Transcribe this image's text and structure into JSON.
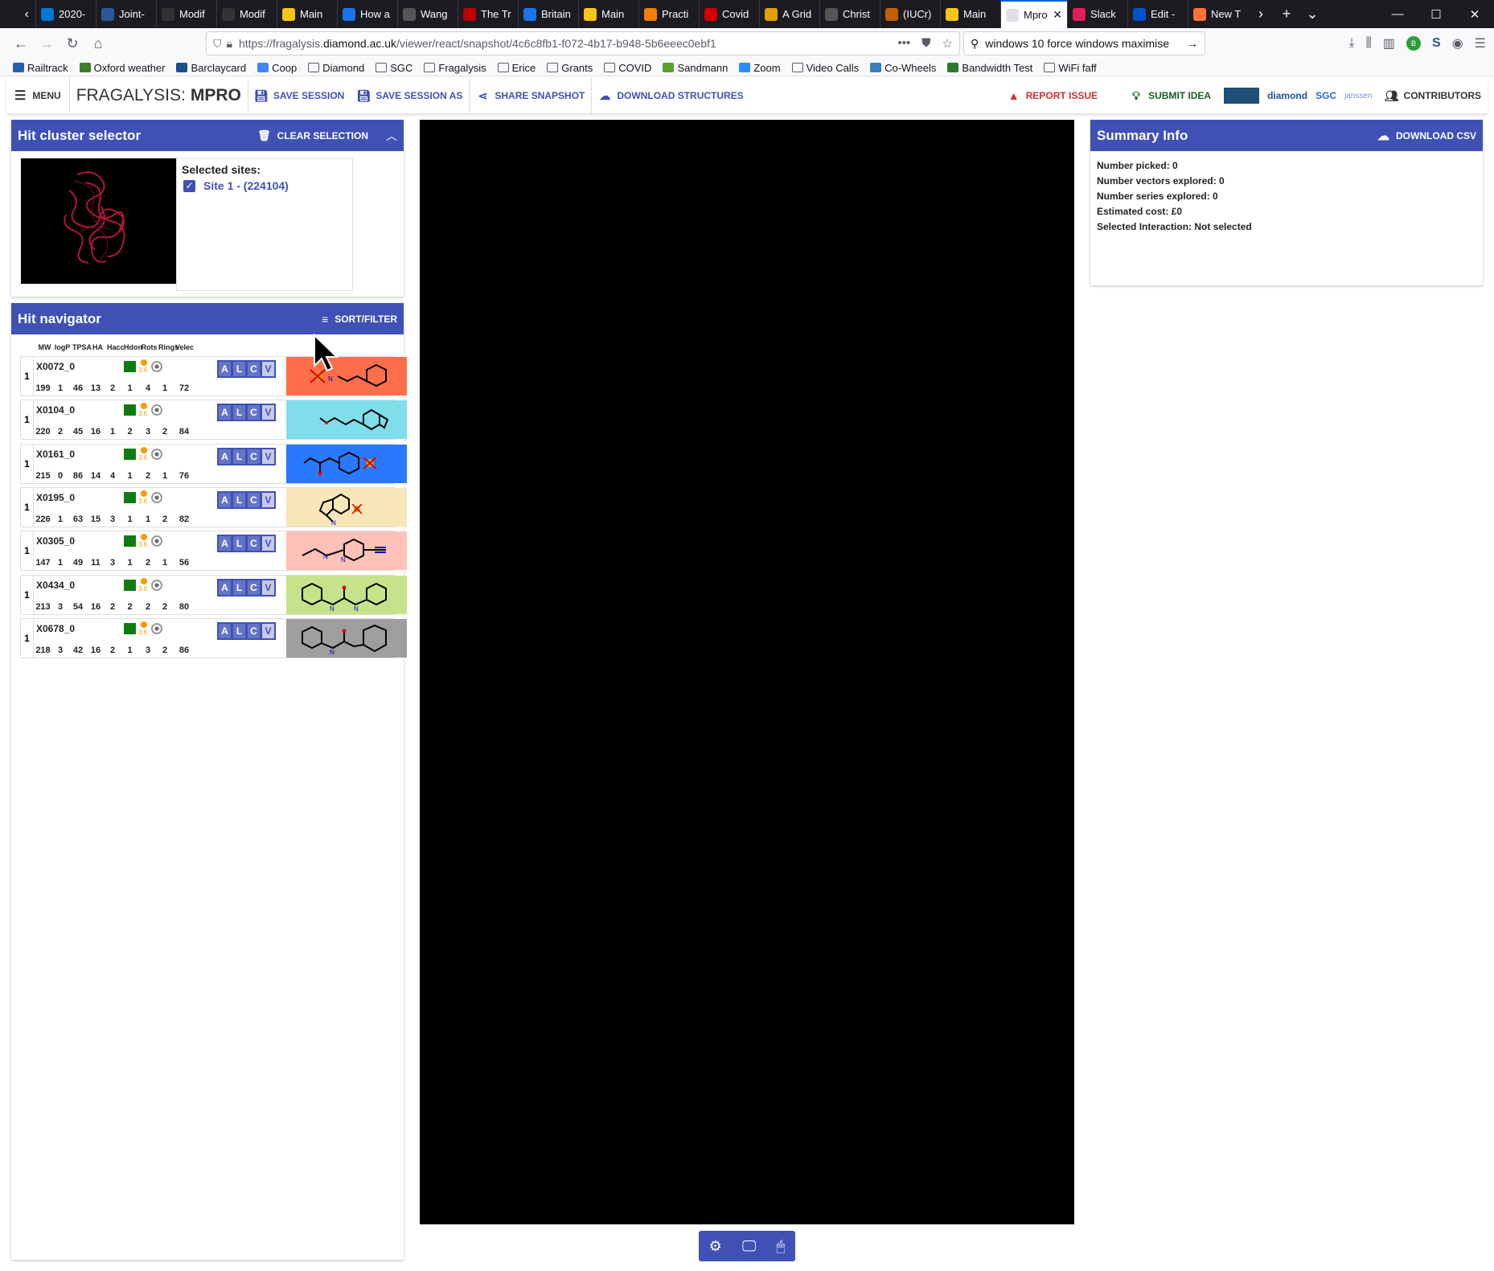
{
  "browser": {
    "tabs": [
      {
        "label": "2020-",
        "color": "#0078d4"
      },
      {
        "label": "Joint-",
        "color": "#2b579a"
      },
      {
        "label": "Modif",
        "color": "#333333"
      },
      {
        "label": "Modif",
        "color": "#333333"
      },
      {
        "label": "Main",
        "color": "#f5c518"
      },
      {
        "label": "How a",
        "color": "#1a73e8"
      },
      {
        "label": "Wang",
        "color": "#555555"
      },
      {
        "label": "The Tr",
        "color": "#c00000"
      },
      {
        "label": "Britain",
        "color": "#1a73e8"
      },
      {
        "label": "Main",
        "color": "#f5c518"
      },
      {
        "label": "Practi",
        "color": "#f57d00"
      },
      {
        "label": "Covid",
        "color": "#d10000"
      },
      {
        "label": "A Grid",
        "color": "#e0a000"
      },
      {
        "label": "Christ",
        "color": "#555555"
      },
      {
        "label": "(IUCr)",
        "color": "#c06000"
      },
      {
        "label": "Main",
        "color": "#f5c518"
      },
      {
        "label": "Mpro",
        "color": "#ffffff",
        "active": true
      },
      {
        "label": "Slack",
        "color": "#e01e5a"
      },
      {
        "label": "Edit -",
        "color": "#0052cc"
      },
      {
        "label": "New T",
        "color": "#ff7139"
      }
    ],
    "url_prefix": "https://fragalysis.",
    "url_domain": "diamond.ac.uk",
    "url_path": "/viewer/react/snapshot/4c6c8fb1-f072-4b17-b948-5b6eeec0ebf1",
    "search_query": "windows 10 force windows maximise",
    "bookmarks": [
      "Railtrack",
      "Oxford weather",
      "Barclaycard",
      "Coop",
      "Diamond",
      "SGC",
      "Fragalysis",
      "Erice",
      "Grants",
      "COVID",
      "Sandmann",
      "Zoom",
      "Video Calls",
      "Co-Wheels",
      "Bandwidth Test",
      "WiFi faff"
    ]
  },
  "appbar": {
    "menu_label": "MENU",
    "brand_prefix": "FRAGALYSIS: ",
    "brand_target": "MPRO",
    "save_session": "SAVE SESSION",
    "save_session_as": "SAVE SESSION AS",
    "share_snapshot": "SHARE SNAPSHOT",
    "download_structures": "DOWNLOAD STRUCTURES",
    "report_issue": "REPORT ISSUE",
    "submit_idea": "SUBMIT IDEA",
    "contributors": "CONTRIBUTORS",
    "logo_diamond": "diamond",
    "logo_sgc": "SGC",
    "logo_janssen": "janssen"
  },
  "cluster_panel": {
    "title": "Hit cluster selector",
    "clear_selection": "CLEAR SELECTION",
    "selected_sites_label": "Selected sites:",
    "site": "Site 1 - (224104)"
  },
  "navigator_panel": {
    "title": "Hit navigator",
    "sort_filter": "SORT/FILTER",
    "columns": [
      "MW",
      "logP",
      "TPSA",
      "HA",
      "Hacc",
      "Hdon",
      "Rots",
      "Rings",
      "Velec"
    ],
    "hits": [
      {
        "idx": "1",
        "code": "X0072_0",
        "props": [
          "199",
          "1",
          "46",
          "13",
          "2",
          "1",
          "4",
          "1",
          "72"
        ],
        "color": "#ff6e4a",
        "dot_value": "3.6"
      },
      {
        "idx": "1",
        "code": "X0104_0",
        "props": [
          "220",
          "2",
          "45",
          "16",
          "1",
          "2",
          "3",
          "2",
          "84"
        ],
        "color": "#80deea",
        "dot_value": "3.6"
      },
      {
        "idx": "1",
        "code": "X0161_0",
        "props": [
          "215",
          "0",
          "86",
          "14",
          "4",
          "1",
          "2",
          "1",
          "76"
        ],
        "color": "#2979ff",
        "dot_value": "3.6"
      },
      {
        "idx": "1",
        "code": "X0195_0",
        "props": [
          "226",
          "1",
          "63",
          "15",
          "3",
          "1",
          "1",
          "2",
          "82"
        ],
        "color": "#f8e6b8",
        "dot_value": "3.6"
      },
      {
        "idx": "1",
        "code": "X0305_0",
        "props": [
          "147",
          "1",
          "49",
          "11",
          "3",
          "1",
          "2",
          "1",
          "56"
        ],
        "color": "#ffc1b8",
        "dot_value": "3.6"
      },
      {
        "idx": "1",
        "code": "X0434_0",
        "props": [
          "213",
          "3",
          "54",
          "16",
          "2",
          "2",
          "2",
          "2",
          "80"
        ],
        "color": "#c5e38a",
        "dot_value": "3.6"
      },
      {
        "idx": "1",
        "code": "X0678_0",
        "props": [
          "218",
          "3",
          "42",
          "16",
          "2",
          "1",
          "3",
          "2",
          "86"
        ],
        "color": "#9e9e9e",
        "dot_value": "3.6"
      }
    ],
    "action_labels": [
      "A",
      "L",
      "C",
      "V"
    ]
  },
  "summary_panel": {
    "title": "Summary Info",
    "download_csv": "DOWNLOAD CSV",
    "lines": [
      "Number picked: 0",
      "Number vectors explored: 0",
      "Number series explored: 0",
      "Estimated cost: £0",
      "Selected Interaction: Not selected"
    ]
  },
  "colors": {
    "primary": "#3f51b5",
    "report": "#d32f2f",
    "idea": "#1b5e20"
  }
}
